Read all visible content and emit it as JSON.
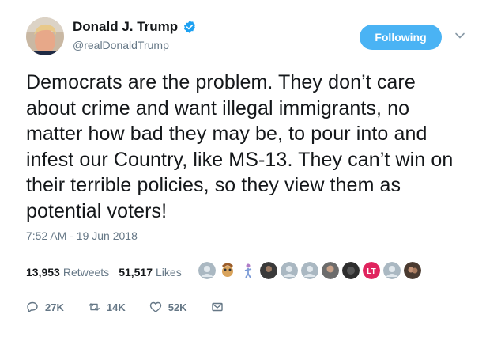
{
  "author": {
    "display_name": "Donald J. Trump",
    "handle": "@realDonaldTrump",
    "verified": true
  },
  "follow_button": {
    "label": "Following"
  },
  "tweet": {
    "text": "Democrats are the problem. They don’t care about crime and want illegal immigrants, no matter how bad they may be, to pour into and infest our Country, like MS-13. They can’t win on their terrible policies, so they view them as potential voters!",
    "timestamp": "7:52 AM - 19 Jun 2018"
  },
  "stats": {
    "retweets_count": "13,953",
    "retweets_label": "Retweets",
    "likes_count": "51,517",
    "likes_label": "Likes"
  },
  "likers": [
    {
      "icon": "default-avatar"
    },
    {
      "icon": "cartoon-avatar"
    },
    {
      "icon": "figure-avatar"
    },
    {
      "icon": "photo-avatar"
    },
    {
      "icon": "default-avatar"
    },
    {
      "icon": "default-avatar"
    },
    {
      "icon": "photo-avatar"
    },
    {
      "icon": "photo-avatar"
    },
    {
      "icon": "lt-logo-avatar",
      "text": "LT"
    },
    {
      "icon": "default-avatar"
    },
    {
      "icon": "photo-avatar"
    }
  ],
  "actions": {
    "replies": "27K",
    "retweets": "14K",
    "likes": "52K"
  },
  "colors": {
    "accent": "#4ab3f4",
    "verified": "#1da1f2",
    "secondary_text": "#657786",
    "divider": "#e6ecf0"
  }
}
